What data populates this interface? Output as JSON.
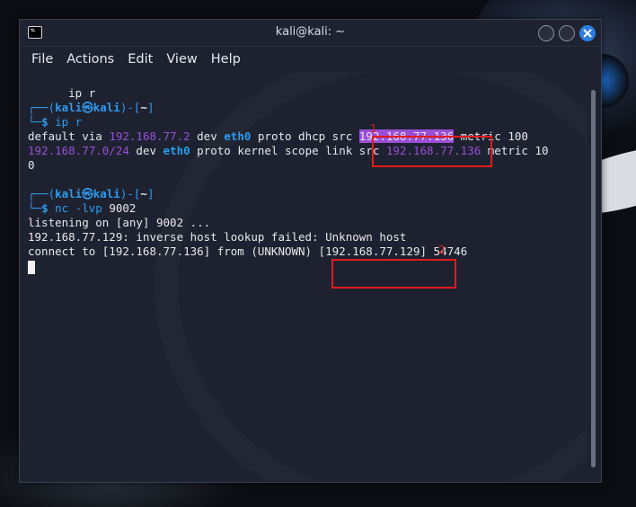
{
  "window": {
    "title": "kali@kali: ~"
  },
  "menu": [
    "File",
    "Actions",
    "Edit",
    "View",
    "Help"
  ],
  "terminal": {
    "line0": "ip r",
    "prompt1": {
      "corner_top": "┌──(",
      "user": "kali㉿kali",
      "close": ")-[",
      "dir": "~",
      "end": "]",
      "corner_bottom": "└─",
      "dollar": "$ ",
      "cmd": "ip r"
    },
    "route1": {
      "p1": "default via ",
      "gw": "192.168.77.2",
      "p2": " dev ",
      "dev": "eth0",
      "p3": " proto dhcp src ",
      "src": "192.168.77.136",
      "p4": " metric 100"
    },
    "route2": {
      "net": "192.168.77.0/24",
      "p1": " dev ",
      "dev": "eth0",
      "p2": " proto kernel scope link src ",
      "src": "192.168.77.136",
      "p3": " metric 10"
    },
    "route2_wrap": "0",
    "prompt2": {
      "corner_top": "┌──(",
      "user": "kali㉿kali",
      "close": ")-[",
      "dir": "~",
      "end": "]",
      "corner_bottom": "└─",
      "dollar": "$ ",
      "cmd": "nc -lvp",
      "arg": " 9002"
    },
    "out1": "listening on [any] 9002 ...",
    "out2": "192.168.77.129: inverse host lookup failed: Unknown host",
    "out3": {
      "p1": "connect to [192.168.77.136] from (UNKNOWN) ",
      "ip": "[192.168.77.129]",
      "p2": " 54746"
    }
  },
  "annotations": {
    "label1": "1",
    "label2": "2",
    "color": "#e01b1b"
  }
}
